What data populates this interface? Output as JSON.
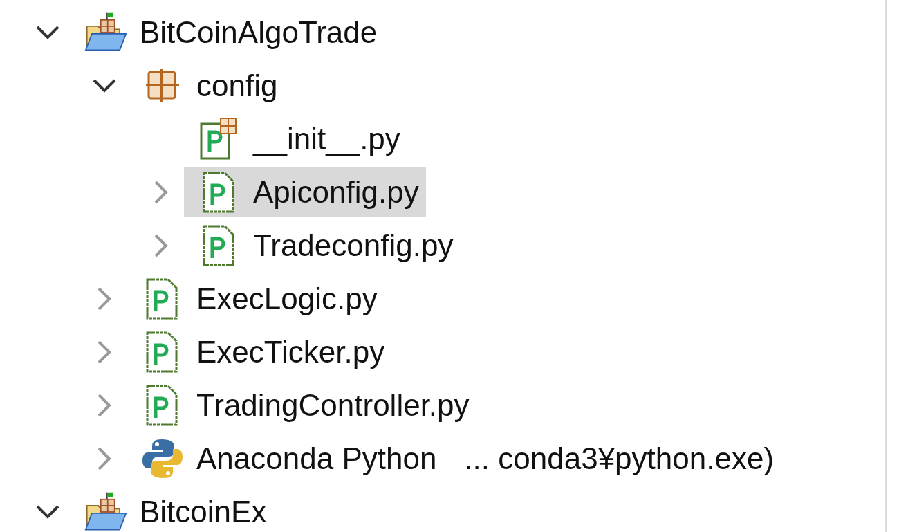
{
  "tree": [
    {
      "kind": "project",
      "label": "BitCoinAlgoTrade",
      "expandable": true,
      "expanded": true,
      "selected": false,
      "children": [
        {
          "kind": "package",
          "label": "config",
          "expandable": true,
          "expanded": true,
          "selected": false,
          "children": [
            {
              "kind": "init",
              "label": "__init__.py",
              "expandable": false,
              "selected": false
            },
            {
              "kind": "pyfile",
              "label": "Apiconfig.py",
              "expandable": true,
              "expanded": false,
              "selected": true
            },
            {
              "kind": "pyfile",
              "label": "Tradeconfig.py",
              "expandable": true,
              "expanded": false,
              "selected": false
            }
          ]
        },
        {
          "kind": "pyfile",
          "label": "ExecLogic.py",
          "expandable": true,
          "expanded": false,
          "selected": false
        },
        {
          "kind": "pyfile",
          "label": "ExecTicker.py",
          "expandable": true,
          "expanded": false,
          "selected": false
        },
        {
          "kind": "pyfile",
          "label": "TradingController.py",
          "expandable": true,
          "expanded": false,
          "selected": false
        },
        {
          "kind": "interpreter",
          "label": "Anaconda Python",
          "detail": "... conda3¥python.exe)",
          "expandable": true,
          "expanded": false,
          "selected": false
        }
      ]
    },
    {
      "kind": "project",
      "label": "BitcoinEx",
      "expandable": true,
      "expanded": true,
      "selected": false
    }
  ]
}
